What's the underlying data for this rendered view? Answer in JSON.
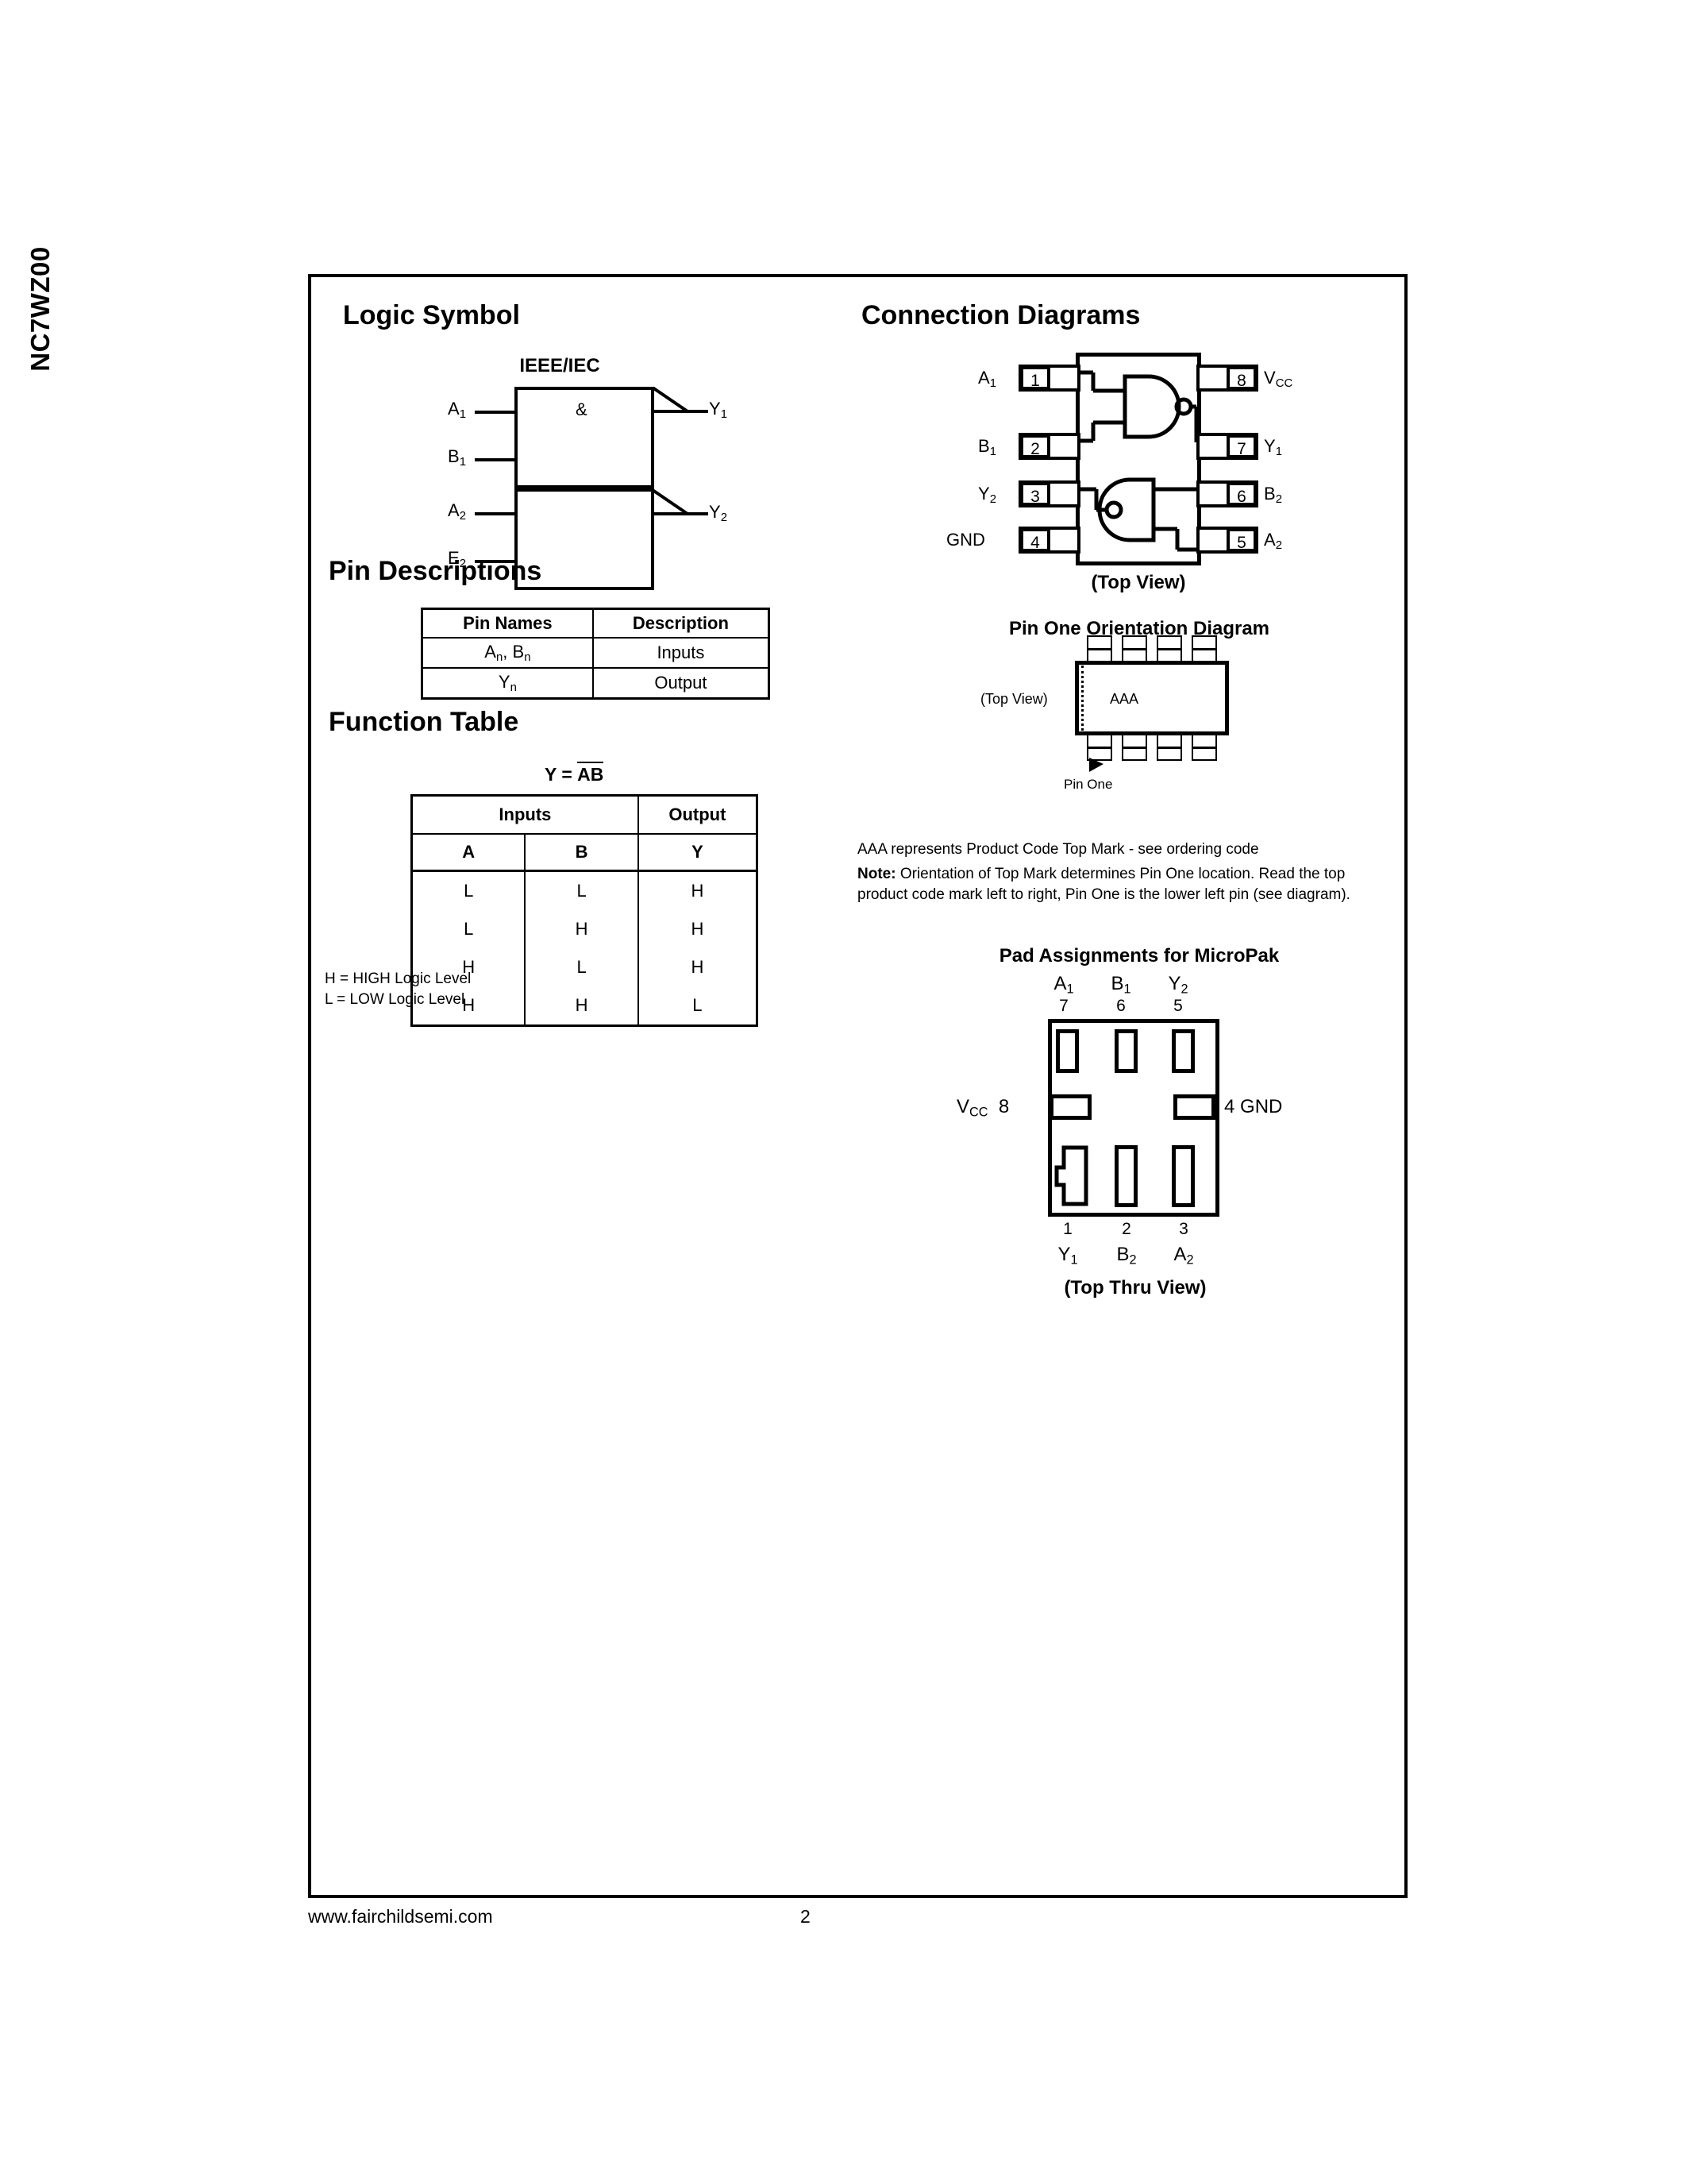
{
  "document": {
    "side_title": "NC7WZ00",
    "footer_url": "www.fairchildsemi.com",
    "page_number": "2"
  },
  "left_column": {
    "logic_symbol": {
      "heading": "Logic Symbol",
      "standard_label": "IEEE/IEC",
      "qualifier": "&",
      "inputs": [
        {
          "name": "A",
          "sub": "1"
        },
        {
          "name": "B",
          "sub": "1"
        },
        {
          "name": "A",
          "sub": "2"
        },
        {
          "name": "E",
          "sub": "2"
        }
      ],
      "outputs": [
        {
          "name": "Y",
          "sub": "1"
        },
        {
          "name": "Y",
          "sub": "2"
        }
      ]
    },
    "pin_descriptions": {
      "heading": "Pin Descriptions",
      "columns": [
        "Pin Names",
        "Description"
      ],
      "rows": [
        {
          "pin_names_main": "A",
          "pin_names_sub": "n",
          "pin_names_main2": "B",
          "pin_names_sub2": "n",
          "description": "Inputs"
        },
        {
          "pin_names_main": "Y",
          "pin_names_sub": "n",
          "description": "Output"
        }
      ]
    },
    "function_table": {
      "heading": "Function Table",
      "equation_lhs": "Y =",
      "equation_rhs": "AB",
      "group_headers": [
        "Inputs",
        "Output"
      ],
      "columns": [
        "A",
        "B",
        "Y"
      ],
      "rows": [
        [
          "L",
          "L",
          "H"
        ],
        [
          "L",
          "H",
          "H"
        ],
        [
          "H",
          "L",
          "H"
        ],
        [
          "H",
          "H",
          "L"
        ]
      ],
      "legend": [
        "H = HIGH Logic Level",
        "L = LOW Logic Level"
      ]
    }
  },
  "right_column": {
    "connection_diagrams": {
      "heading": "Connection Diagrams",
      "view_caption": "(Top View)",
      "left_pins": [
        {
          "number": "1",
          "label_main": "A",
          "label_sub": "1"
        },
        {
          "number": "2",
          "label_main": "B",
          "label_sub": "1"
        },
        {
          "number": "3",
          "label_main": "Y",
          "label_sub": "2"
        },
        {
          "number": "4",
          "label_main": "GND",
          "label_sub": ""
        }
      ],
      "right_pins": [
        {
          "number": "8",
          "label_main": "V",
          "label_sub": "CC"
        },
        {
          "number": "7",
          "label_main": "Y",
          "label_sub": "1"
        },
        {
          "number": "6",
          "label_main": "B",
          "label_sub": "2"
        },
        {
          "number": "5",
          "label_main": "A",
          "label_sub": "2"
        }
      ]
    },
    "pin_one_orientation": {
      "heading": "Pin One Orientation Diagram",
      "view_label": "(Top View)",
      "top_mark": "AAA",
      "pin_one_label": "Pin One",
      "note_line1": "AAA represents Product Code Top Mark - see ordering code",
      "note_bold": "Note:",
      "note_line2": "Orientation of Top Mark determines Pin One location. Read the top",
      "note_line3": "product code mark left to right, Pin One is the lower left pin (see diagram)."
    },
    "pad_assignments": {
      "heading": "Pad Assignments for MicroPak",
      "view_caption": "(Top Thru View)",
      "top_pads": [
        {
          "label_main": "A",
          "label_sub": "1",
          "number": "7"
        },
        {
          "label_main": "B",
          "label_sub": "1",
          "number": "6"
        },
        {
          "label_main": "Y",
          "label_sub": "2",
          "number": "5"
        }
      ],
      "bottom_pads": [
        {
          "number": "1",
          "label_main": "Y",
          "label_sub": "1"
        },
        {
          "number": "2",
          "label_main": "B",
          "label_sub": "2"
        },
        {
          "number": "3",
          "label_main": "A",
          "label_sub": "2"
        }
      ],
      "left_pad": {
        "label_main": "V",
        "label_sub": "CC",
        "number": "8"
      },
      "right_pad": {
        "number": "4",
        "label_main": "GND",
        "label_sub": ""
      }
    }
  }
}
